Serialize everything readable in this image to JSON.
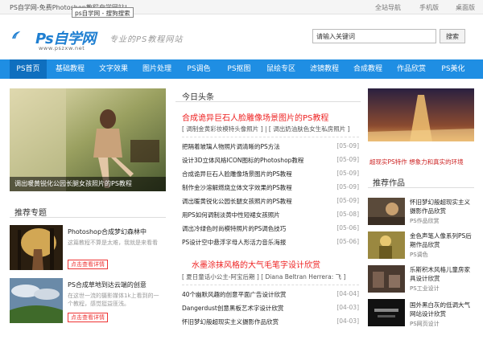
{
  "topbar": {
    "site_title": "PS自学网-免费Photoshop教程自学网站!",
    "tooltip": "ps自学网 - 搜狗搜索",
    "links": [
      "全站导航",
      "手机版",
      "桌面版"
    ]
  },
  "header": {
    "logo_text": "Ps自学网",
    "logo_url": "www.pszxw.net",
    "slogan": "专业的PS教程网站",
    "search_placeholder": "请输入关键词",
    "search_button": "搜索"
  },
  "nav": [
    "PS首页",
    "基础教程",
    "文字效果",
    "图片处理",
    "PS调色",
    "PS抠图",
    "鼠绘专区",
    "滤镜教程",
    "合成教程",
    "作品欣赏",
    "PS美化"
  ],
  "hero": {
    "caption": "调出暖黄锐化公园长腿女孩照片的PS教程"
  },
  "recommend": {
    "title": "推荐专题",
    "items": [
      {
        "title": "Photoshop合成梦幻森林中",
        "desc": "这篇教程不算是太难，我就是来看看",
        "button": "点击查看详情"
      },
      {
        "title": "PS合成草地到达云端的创意",
        "desc": "在这世一流的摄影媒体1k上看到的一个教程，感觉挺益匪浅。",
        "button": "点击查看详情"
      }
    ]
  },
  "today": {
    "title": "今日头条",
    "groups": [
      {
        "headline": "合成诡异巨石人脸雕像场景图片的PS教程",
        "sub": "[ 调制金黄彩妆模特头像照片 ] | [ 调出奶油肤色女生私房照片 ]",
        "items": [
          {
            "title": "把隔着玻璃人物照片调清晰的PS方法",
            "date": "[05-09]"
          },
          {
            "title": "设计3D立体风格ICON图标的Photoshop教程",
            "date": "[05-09]"
          },
          {
            "title": "合成诡异巨石人脸雕像场景图片的PS教程",
            "date": "[05-09]"
          },
          {
            "title": "制作金沙溶解燃烧立体文字效果的PS教程",
            "date": "[05-09]"
          },
          {
            "title": "调出暖黄锐化公园长腿女孩照片的PS教程",
            "date": "[05-09]"
          },
          {
            "title": "用PS如何调制淡黄中性短裙女孩照片",
            "date": "[05-08]"
          },
          {
            "title": "调出冷绿色时尚模特照片的PS调色技巧",
            "date": "[05-06]"
          },
          {
            "title": "PS设计空中悬浮字母人形活力音乐海报",
            "date": "[05-06]"
          }
        ]
      },
      {
        "headline": "水墨涂抹风格的大气毛笔字设计欣赏",
        "sub": "[ 夏日童话小公主-阿宝后期 ] [ Diana Beltran Herrera: 飞 ]",
        "items": [
          {
            "title": "40个幽默风趣的创意平面广告设计欣赏",
            "date": "[04-04]"
          },
          {
            "title": "Dangerdust创意黑板艺术字设计欣赏",
            "date": "[04-03]"
          },
          {
            "title": "怀旧梦幻般超现实主义摄影作品欣赏",
            "date": "[04-03]"
          }
        ]
      }
    ]
  },
  "right": {
    "caption": "超现实PS特作 想象力和真实的环境",
    "works_title": "推荐作品",
    "works": [
      {
        "title": "怀旧梦幻般超现实主义摄影作品欣赏",
        "cat": "PS作品欣赏"
      },
      {
        "title": "金色声笔人像系列PS后期作品欣赏",
        "cat": "PS调色"
      },
      {
        "title": "乐斯积木风格儿童房家具设计欣赏",
        "cat": "PS工业设计"
      },
      {
        "title": "国外黑白灰的低调大气网站设计欣赏",
        "cat": "PS网页设计"
      }
    ]
  },
  "colors": {
    "nav": "#1f8ee3",
    "nav_active": "#0f6fbf",
    "headline": "#e22222",
    "logo": "#1f7fd1"
  }
}
